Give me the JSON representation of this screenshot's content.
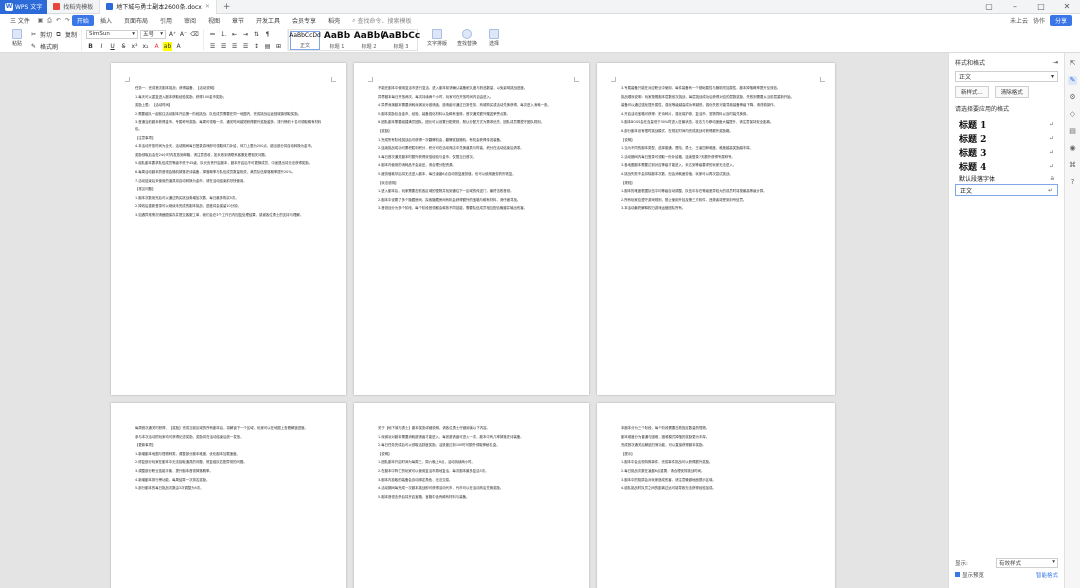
{
  "titlebar": {
    "app_name": "WPS 文字",
    "tabs": [
      {
        "label": "找稻壳模板",
        "icon_color": "#e8463a"
      },
      {
        "label": "地下城与勇士副本2600条.docx",
        "icon_color": "#2b6ad8"
      }
    ],
    "new_tab": "+"
  },
  "menubar": {
    "file": "三 文件",
    "items": [
      "开始",
      "插入",
      "页面布局",
      "引用",
      "审阅",
      "视图",
      "章节",
      "开发工具",
      "会员专享",
      "稻壳"
    ],
    "active": "开始",
    "search_label": "查找命令、搜索模板",
    "right": {
      "sync": "未上云",
      "collab": "协作",
      "share": "分享"
    }
  },
  "ribbon": {
    "paste": "粘贴",
    "cut": "剪切",
    "copy": "复制",
    "format_painter": "格式刷",
    "font_name": "SimSun",
    "font_size": "五号",
    "styles": [
      {
        "sample": "AaBbCcDd",
        "name": "正文",
        "big": false
      },
      {
        "sample": "AaBb",
        "name": "标题 1",
        "big": true
      },
      {
        "sample": "AaBb(",
        "name": "标题 2",
        "big": true
      },
      {
        "sample": "AaBbCc",
        "name": "标题 3",
        "big": true
      }
    ],
    "text_tools": "文字排版",
    "find_replace": "查找替换",
    "select": "选择"
  },
  "pages": [
    {
      "paragraphs": [
        "任务一：完成首次副本挑战；获得装备，【活动说明】",
        "1.每天可以重复进入副本获取经验奖励，获得100金币奖励；",
        "奖励上限：【活动时间】",
        "2.需要组队一起前往活动副本开启第一阶段挑战，队伍成员需要在同一地图内，完成挑战后返回城镇领取奖励。",
        "3.首通当前副本获得金币、专属称号奖励，每周可领取一次，通关时间越短获得额外奖励越多，排行榜前十名可领取稀有材料包。",
        "【注意事项】",
        "4.本活动开放时间为全天，活动期间每日登录游戏即可领取体力补给，体力上限为200点，超出部分将自动转换为金币。",
        "奖励领取后会在24小时内发放到邮箱，请注意查收，如未收到请联系客服处理相关问题。",
        "5.组队副本要求队伍成员等级不低于45级，队长负责开启副本，副本开启后不可更换成员，中途退出将无法获得奖励。",
        "6.每周活动副本的首领会随机掉落史诗装备，掉落概率与队伍成员数量相关，满员队伍掉落概率提升20%。",
        "7.活动结束后未使用的道具将自动转换为金币，请在活动结束前尽快使用。",
        "【常见问题】",
        "1.副本次数用完后可以通过购买挑战券增加次数，每日最多购买5次。",
        "2.掉线后重新登录可以继续未完成的副本挑战，进度将会保留10分钟。",
        "3.如遇异常情况请截图保存并提交客服工单，我们会在3个工作日内回复处理结果，感谢各位勇士的支持与理解。"
      ]
    },
    {
      "paragraphs": [
        "不能在副本中使用复活币进行复活，进入副本前请确认装备耐久度与药品数量，以免影响挑战进度。",
        "异界副本每日开放两次，每次持续两个小时，玩家可在开放时间内自由进入。",
        "4.异界深渊副本需要消耗深渊派对邀请函，邀请函可通过日常任务、商城购买或活动兑换获得，每次进入消耗一张。",
        "5.副本奖励包含金币、经验、装备强化材料以及稀有宝珠，首次通关额外赠送荣誉点数。",
        "6.团队副本需要组建满员团队，团长可以设置分配规则，默认分配方式为需求优先，团队成员需遵守团队规则。",
        "【奖励】",
        "1.完成所有阶段挑战后可获得一次翻牌机会，翻牌奖励随机，有机会获得传说装备。",
        "2.连续挑战成功可累积胜利积分，积分可在活动商店中兑换道具与时装，积分在活动结束后清零。",
        "3.每日首次通关副本时额外获得双倍经验与金币，仅限当日首次。",
        "4.副本内使用的消耗品不会返还，请合理分配资源。",
        "5.疲劳值耗尽后将无法进入副本，每日凌晨6点自动恢复疲劳值，也可以使用疲劳药剂恢复。",
        "【玩法说明】",
        "1.进入副本后，玩家需要击败各区域的怪物并找到通往下一区域的传送门，最终击败首领。",
        "2.副本中设置了多个隐藏房间，探索隐藏房间有机会获得额外的宝箱与稀有材料，请仔细寻找。",
        "3.首领战分为多个阶段，每个阶段首领都会释放不同技能，需要队伍成员相互配合躲避并输出伤害。"
      ]
    },
    {
      "paragraphs": [
        "3.专属装备只能在对应职业中使用，每件装备有一个基础属性与随机附加属性，副本掉落概率提升至双倍。",
        "挑战顺序说明：玩家按照副本层数依次挑战，每层挑战成功后获得对应的层数奖励，失败则需要从当前层重新开始。",
        "装备可以通过强化提升属性，强化等级越高成功率越低，强化失败可能导致装备等级下降，请谨慎操作。",
        "4.开启活动宝箱可获得：史诗碎片、强化保护券、复活币、宠物饲料以及时装兑换券。",
        "5.副本BOSS会在血量低于30%时进入狂暴状态，攻击力与移动速度大幅提升，请注意保持安全距离。",
        "6.部分副本设有限时挑战模式，在规定时间内完成挑战可获得额外奖励箱。",
        "【说明】",
        "1.当为不同的副本类型，选择普通、冒险、勇士、王者四种难度，难度越高奖励越丰厚。",
        "2.活动期间内每日登录可领取一份补给箱，连续登录7天额外获得专属称号。",
        "3.各地图副本需要达到对应等级才能进入，未达到等级要求的玩家无法进入。",
        "4.挑战失败不会扣除副本次数，但会消耗疲劳值，玩家可以再次尝试挑战。",
        "【规则】",
        "1.副本的难度根据队伍平均等级自动调整，队伍中存在等级差异较大的成员时将按最高等级计算。",
        "2.所有玩家应遵守游戏规则，禁止使用外挂及第三方软件，违规者将受到封号处罚。",
        "3.本活动最终解释权归游戏运营团队所有。"
      ]
    },
    {
      "paragraphs": [
        "每周首次通关时获得，【奖励】完成当前区域的所有副本后，将解锁下一个区域，玩家可以在地图上查看解锁进度。",
        "参与本次活动的玩家均可获得纪念奖励，奖励将在活动结束后统一发放。",
        "【更新事项】",
        "1.新增副本地图与怪物种类，调整部分副本难度，优化副本加载速度。",
        "2.修复部分玩家在副本中无法拾取道具的问题，修复组队匹配异常的问题。",
        "3.调整部分职业技能平衡，提升副本首领掉落概率。",
        "4.新增副本排行榜功能，每周结算一次排名奖励。",
        "5.部分副本的每日挑战次数由3次调整为5次。"
      ]
    },
    {
      "paragraphs": [
        "关于【地下城与勇士】副本奖励详细说明，请各位勇士仔细阅读以下内容。",
        "1.深渊派对副本需要消耗邀请函才能进入，每张邀请函可进入一次，副本中有几率掉落史诗装备。",
        "2.每日任务完成后可以领取活跃度奖励，活跃度达到100时可额外领取神秘礼盒。",
        "【说明】",
        "1.团队副本开启时间为每周三、周六晚上8点，活动持续两小时。",
        "2.在副本中阵亡的玩家可以使用复活币原地复活，每次副本最多复活3次。",
        "3.副本内拾取的装备会自动绑定角色，无法交易。",
        "4.活动期间每完成一次副本挑战即可获得活动代币，代币可以在活动商店兑换奖励。",
        "5.副本首领击杀后将开启宝箱，宝箱中含有稀有材料与装备。"
      ]
    },
    {
      "paragraphs": [
        "本副本分为三个阶段，每个阶段需要击败指定数量的怪物。",
        "副本难度分为普通与困难，困难模式掉落的奖励更为丰厚。",
        "完成首次通关后解锁扫荡功能，可以直接获得副本奖励。",
        "【提示】",
        "1.副本中会出现特殊事件，完成事件挑战可以获得额外奖励。",
        "2.每日挑战次数在凌晨6点重置，请合理安排挑战时间。",
        "3.副本中的陷阱会对玩家造成伤害，请注意躲避地面提示区域。",
        "4.组队挑战时队员之间的距离过远可能导致无法获得经验加成。"
      ]
    }
  ],
  "right_panel": {
    "title": "样式和格式",
    "current_style": "正文",
    "new_style": "新样式...",
    "clear_format": "清除格式",
    "apply_label": "请选择要应用的格式",
    "styles": [
      {
        "label": "标题 1",
        "type": "heading"
      },
      {
        "label": "标题 2",
        "type": "heading"
      },
      {
        "label": "标题 3",
        "type": "heading"
      },
      {
        "label": "标题 4",
        "type": "heading"
      },
      {
        "label": "默认段落字体",
        "type": "small"
      },
      {
        "label": "正文",
        "type": "current"
      }
    ],
    "show_label": "显示:",
    "show_value": "有效样式",
    "preview_label": "显示预览",
    "smart_label": "智能格式"
  }
}
